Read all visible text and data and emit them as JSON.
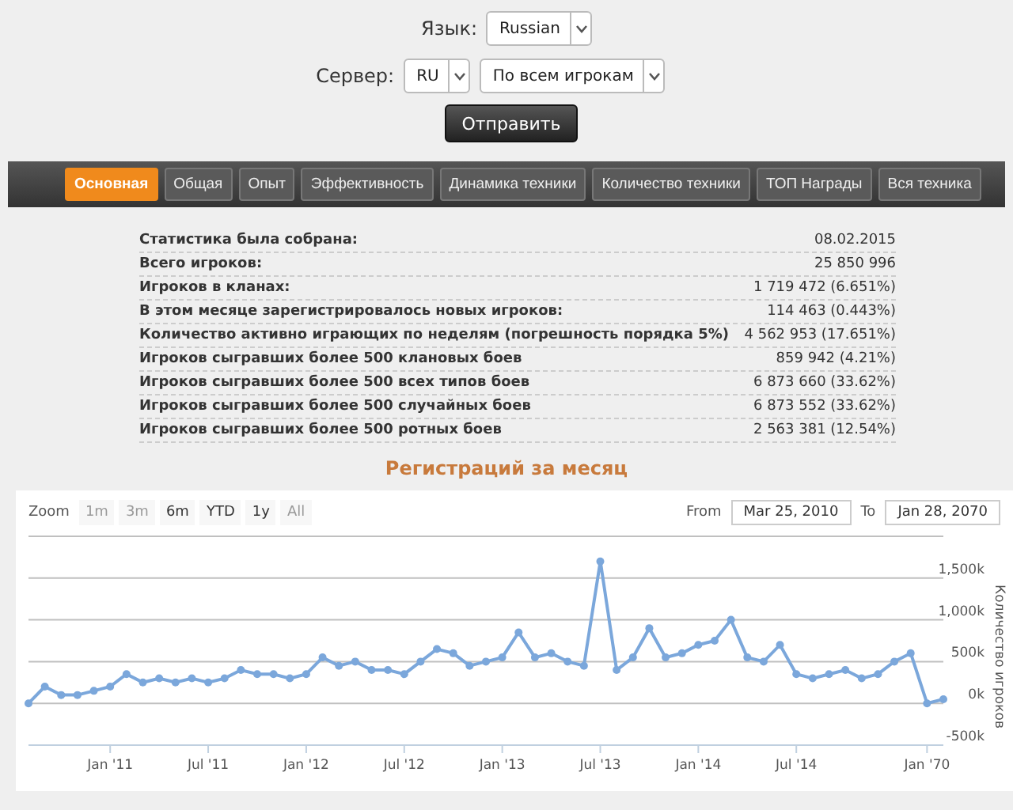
{
  "form": {
    "language": {
      "label": "Язык:",
      "value": "Russian"
    },
    "server": {
      "label": "Сервер:",
      "value": "RU"
    },
    "scope": {
      "value": "По всем игрокам"
    },
    "submit": "Отправить"
  },
  "tabs": [
    {
      "label": "Основная",
      "selected": true
    },
    {
      "label": "Общая",
      "selected": false
    },
    {
      "label": "Опыт",
      "selected": false
    },
    {
      "label": "Эффективность",
      "selected": false
    },
    {
      "label": "Динамика техники",
      "selected": false
    },
    {
      "label": "Количество техники",
      "selected": false
    },
    {
      "label": "ТОП Награды",
      "selected": false
    },
    {
      "label": "Вся техника",
      "selected": false
    }
  ],
  "stats": [
    {
      "label": "Статистика была собрана:",
      "value": "08.02.2015"
    },
    {
      "label": "Всего игроков:",
      "value": "25 850 996"
    },
    {
      "label": "Игроков в кланах:",
      "value": "1 719 472 (6.651%)"
    },
    {
      "label": "В этом месяце зарегистрировалось новых игроков:",
      "value": "114 463 (0.443%)"
    },
    {
      "label": "Количество активно играющих по неделям (погрешность порядка 5%)",
      "value": "4 562 953 (17.651%)"
    },
    {
      "label": "Игроков сыгравших более 500 клановых боев",
      "value": "859 942 (4.21%)"
    },
    {
      "label": "Игроков сыгравших более 500 всех типов боев",
      "value": "6 873 660 (33.62%)"
    },
    {
      "label": "Игроков сыгравших более 500 случайных боев",
      "value": "6 873 552 (33.62%)"
    },
    {
      "label": "Игроков сыгравших более 500 ротных боев",
      "value": "2 563 381 (12.54%)"
    }
  ],
  "chart": {
    "title": "Регистраций за месяц",
    "zoom_label": "Zoom",
    "zoom_buttons": [
      {
        "label": "1m",
        "disabled": true
      },
      {
        "label": "3m",
        "disabled": true
      },
      {
        "label": "6m",
        "disabled": false
      },
      {
        "label": "YTD",
        "disabled": false
      },
      {
        "label": "1y",
        "disabled": false
      },
      {
        "label": "All",
        "disabled": true
      }
    ],
    "from_label": "From",
    "from_value": "Mar 25, 2010",
    "to_label": "To",
    "to_value": "Jan 28, 2070",
    "chart_data": {
      "type": "line",
      "ylabel": "Количество игроков",
      "categories": [
        null,
        null,
        null,
        null,
        null,
        "Jan '11",
        null,
        null,
        null,
        null,
        null,
        "Jul '11",
        null,
        null,
        null,
        null,
        null,
        "Jan '12",
        null,
        null,
        null,
        null,
        null,
        "Jul '12",
        null,
        null,
        null,
        null,
        null,
        "Jan '13",
        null,
        null,
        null,
        null,
        null,
        "Jul '13",
        null,
        null,
        null,
        null,
        null,
        "Jan '14",
        null,
        null,
        null,
        null,
        null,
        "Jul '14",
        null,
        null,
        null,
        null,
        null,
        null,
        null,
        "Jan '70",
        null
      ],
      "grid": true,
      "series": [
        {
          "color": "#7ba7db",
          "marker": true,
          "values": [
            0,
            200,
            100,
            100,
            150,
            200,
            350,
            250,
            300,
            250,
            300,
            250,
            300,
            400,
            350,
            350,
            300,
            350,
            550,
            450,
            500,
            400,
            400,
            350,
            500,
            650,
            600,
            450,
            500,
            550,
            850,
            550,
            600,
            500,
            450,
            1700,
            400,
            550,
            900,
            550,
            600,
            700,
            750,
            1000,
            550,
            500,
            700,
            350,
            300,
            350,
            400,
            300,
            350,
            500,
            600,
            0,
            50
          ]
        }
      ],
      "ylim": [
        -500,
        2000
      ],
      "yticks": [
        {
          "value": -500,
          "label": "-500k"
        },
        {
          "value": 0,
          "label": "0k"
        },
        {
          "value": 500,
          "label": "500k"
        },
        {
          "value": 1000,
          "label": "1,000k"
        },
        {
          "value": 1500,
          "label": "1,500k"
        }
      ]
    }
  }
}
